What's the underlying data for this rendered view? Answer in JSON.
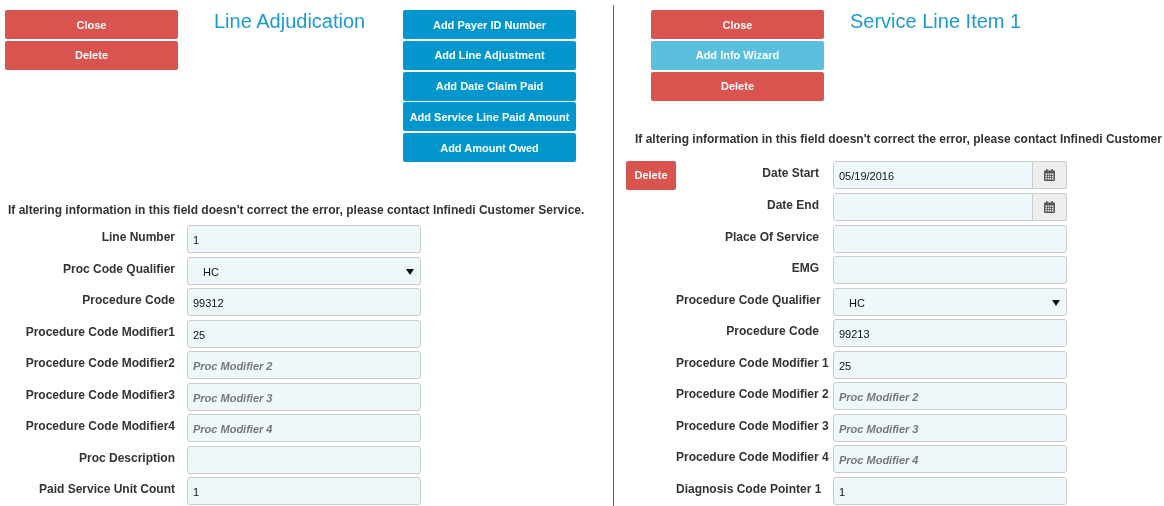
{
  "left_panel": {
    "buttons": [
      {
        "label": "Close",
        "kind": "danger"
      },
      {
        "label": "Delete",
        "kind": "danger"
      }
    ],
    "title": "Line Adjudication",
    "add_buttons": [
      "Add Payer ID Number",
      "Add Line Adjustment",
      "Add Date Claim Paid",
      "Add Service Line Paid Amount",
      "Add Amount Owed"
    ],
    "notice": "If altering information in this field doesn't correct the error, please contact Infinedi Customer Service.",
    "fields": [
      {
        "label": "Line Number",
        "kind": "text",
        "value": "1"
      },
      {
        "label": "Proc Code Qualifier",
        "kind": "select",
        "value": "HC"
      },
      {
        "label": "Procedure Code",
        "kind": "text",
        "value": "99312"
      },
      {
        "label": "Procedure Code Modifier1",
        "kind": "text",
        "value": "25"
      },
      {
        "label": "Procedure Code Modifier2",
        "kind": "text",
        "placeholder": "Proc Modifier 2"
      },
      {
        "label": "Procedure Code Modifier3",
        "kind": "text",
        "placeholder": "Proc Modifier 3"
      },
      {
        "label": "Procedure Code Modifier4",
        "kind": "text",
        "placeholder": "Proc Modifier 4"
      },
      {
        "label": "Proc Description",
        "kind": "text"
      },
      {
        "label": "Paid Service Unit Count",
        "kind": "text",
        "value": "1"
      }
    ]
  },
  "right_panel": {
    "buttons": [
      {
        "label": "Close",
        "kind": "danger"
      },
      {
        "label": "Add Info Wizard",
        "kind": "info"
      },
      {
        "label": "Delete",
        "kind": "danger"
      }
    ],
    "title": "Service Line Item 1",
    "notice": "If altering information in this field doesn't correct the error, please contact Infinedi Customer",
    "row_delete_button": "Delete",
    "fields": [
      {
        "label": "Date Start",
        "kind": "date",
        "value": "05/19/2016"
      },
      {
        "label": "Date End",
        "kind": "date"
      },
      {
        "label": "Place Of Service",
        "kind": "text"
      },
      {
        "label": "EMG",
        "kind": "text"
      },
      {
        "label": "Procedure Code Qualifier",
        "kind": "select",
        "value": "HC"
      },
      {
        "label": "Procedure Code",
        "kind": "text",
        "value": "99213"
      },
      {
        "label": "Procedure Code Modifier 1",
        "kind": "text",
        "value": "25"
      },
      {
        "label": "Procedure Code Modifier 2",
        "kind": "text",
        "placeholder": "Proc Modifier 2"
      },
      {
        "label": "Procedure Code Modifier 3",
        "kind": "text",
        "placeholder": "Proc Modifier 3"
      },
      {
        "label": "Procedure Code Modifier 4",
        "kind": "text",
        "placeholder": "Proc Modifier 4"
      },
      {
        "label": "Diagnosis Code Pointer 1",
        "kind": "text",
        "value": "1"
      }
    ]
  }
}
